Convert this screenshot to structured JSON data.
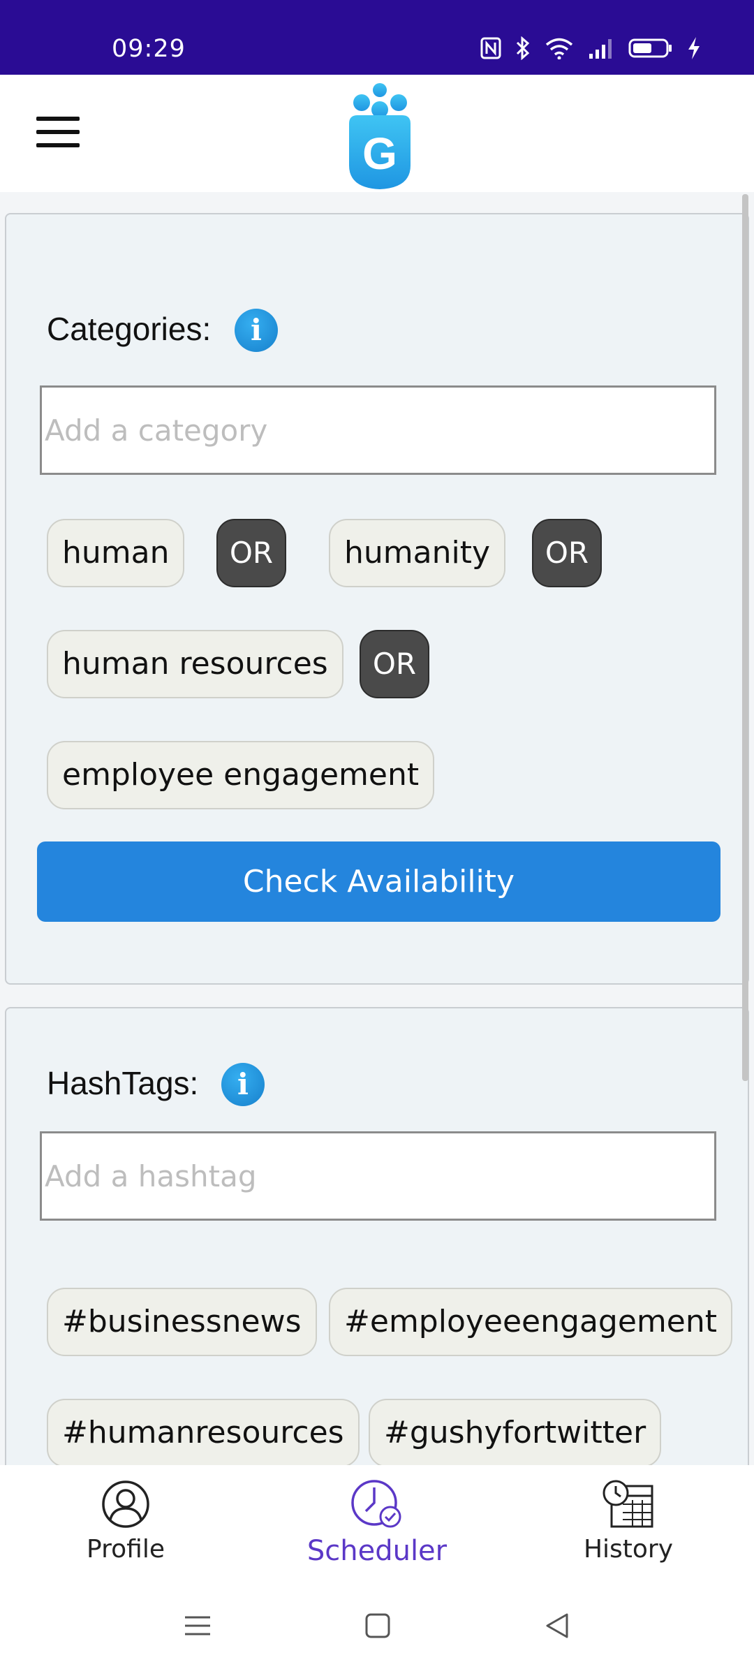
{
  "status_bar": {
    "time": "09:29",
    "icons": [
      "nfc-icon",
      "bluetooth-icon",
      "wifi-icon",
      "signal-icon",
      "battery-icon",
      "charging-icon"
    ]
  },
  "app_bar": {
    "logo_letter": "G"
  },
  "categories": {
    "title": "Categories:",
    "info": "i",
    "input_placeholder": "Add a category",
    "input_value": "",
    "chips": [
      "human",
      "humanity",
      "human resources",
      "employee engagement"
    ],
    "operator": "OR",
    "check_button": "Check Availability"
  },
  "hashtags": {
    "title": "HashTags:",
    "info": "i",
    "input_placeholder": "Add a hashtag",
    "input_value": "",
    "chips": [
      "#businessnews",
      "#employeeengagement",
      "#humanresources",
      "#gushyfortwitter"
    ]
  },
  "bottom_nav": {
    "items": [
      {
        "label": "Profile",
        "icon": "profile-icon"
      },
      {
        "label": "Scheduler",
        "icon": "scheduler-icon",
        "active": true
      },
      {
        "label": "History",
        "icon": "history-icon"
      }
    ]
  },
  "colors": {
    "status_bar": "#2a0c94",
    "accent": "#2485dd",
    "active_nav": "#5b38c7",
    "operator_chip": "#4a4a4a",
    "card_bg": "#eef3f6"
  }
}
